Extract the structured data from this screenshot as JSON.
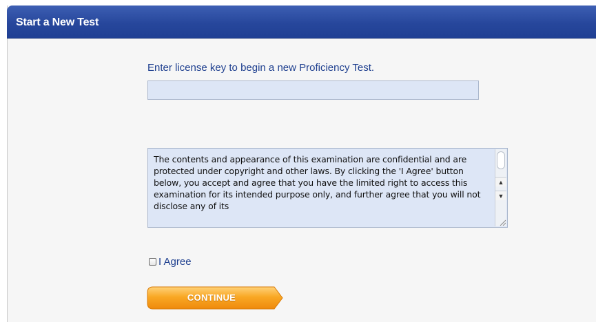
{
  "header": {
    "title": "Start a New Test"
  },
  "license": {
    "instruction": "Enter license key to begin a new Proficiency Test.",
    "value": "",
    "placeholder": ""
  },
  "terms": {
    "text": "The contents and appearance of this examination are confidential and are protected under copyright and other laws. By clicking the 'I Agree' button below, you accept and agree that you have the limited right to access this examination for its intended purpose only, and further agree that you will not disclose any of its"
  },
  "agree": {
    "label": "I Agree",
    "checked": false
  },
  "continue_button": {
    "label": "CONTINUE"
  },
  "colors": {
    "header_blue": "#27479c",
    "link_blue": "#1e3f8f",
    "field_fill": "#dde6f6",
    "button_orange": "#f7a21c"
  },
  "icons": {
    "scroll_up": "up-arrow-icon",
    "scroll_down": "down-arrow-icon",
    "resize": "resize-grip-icon"
  }
}
